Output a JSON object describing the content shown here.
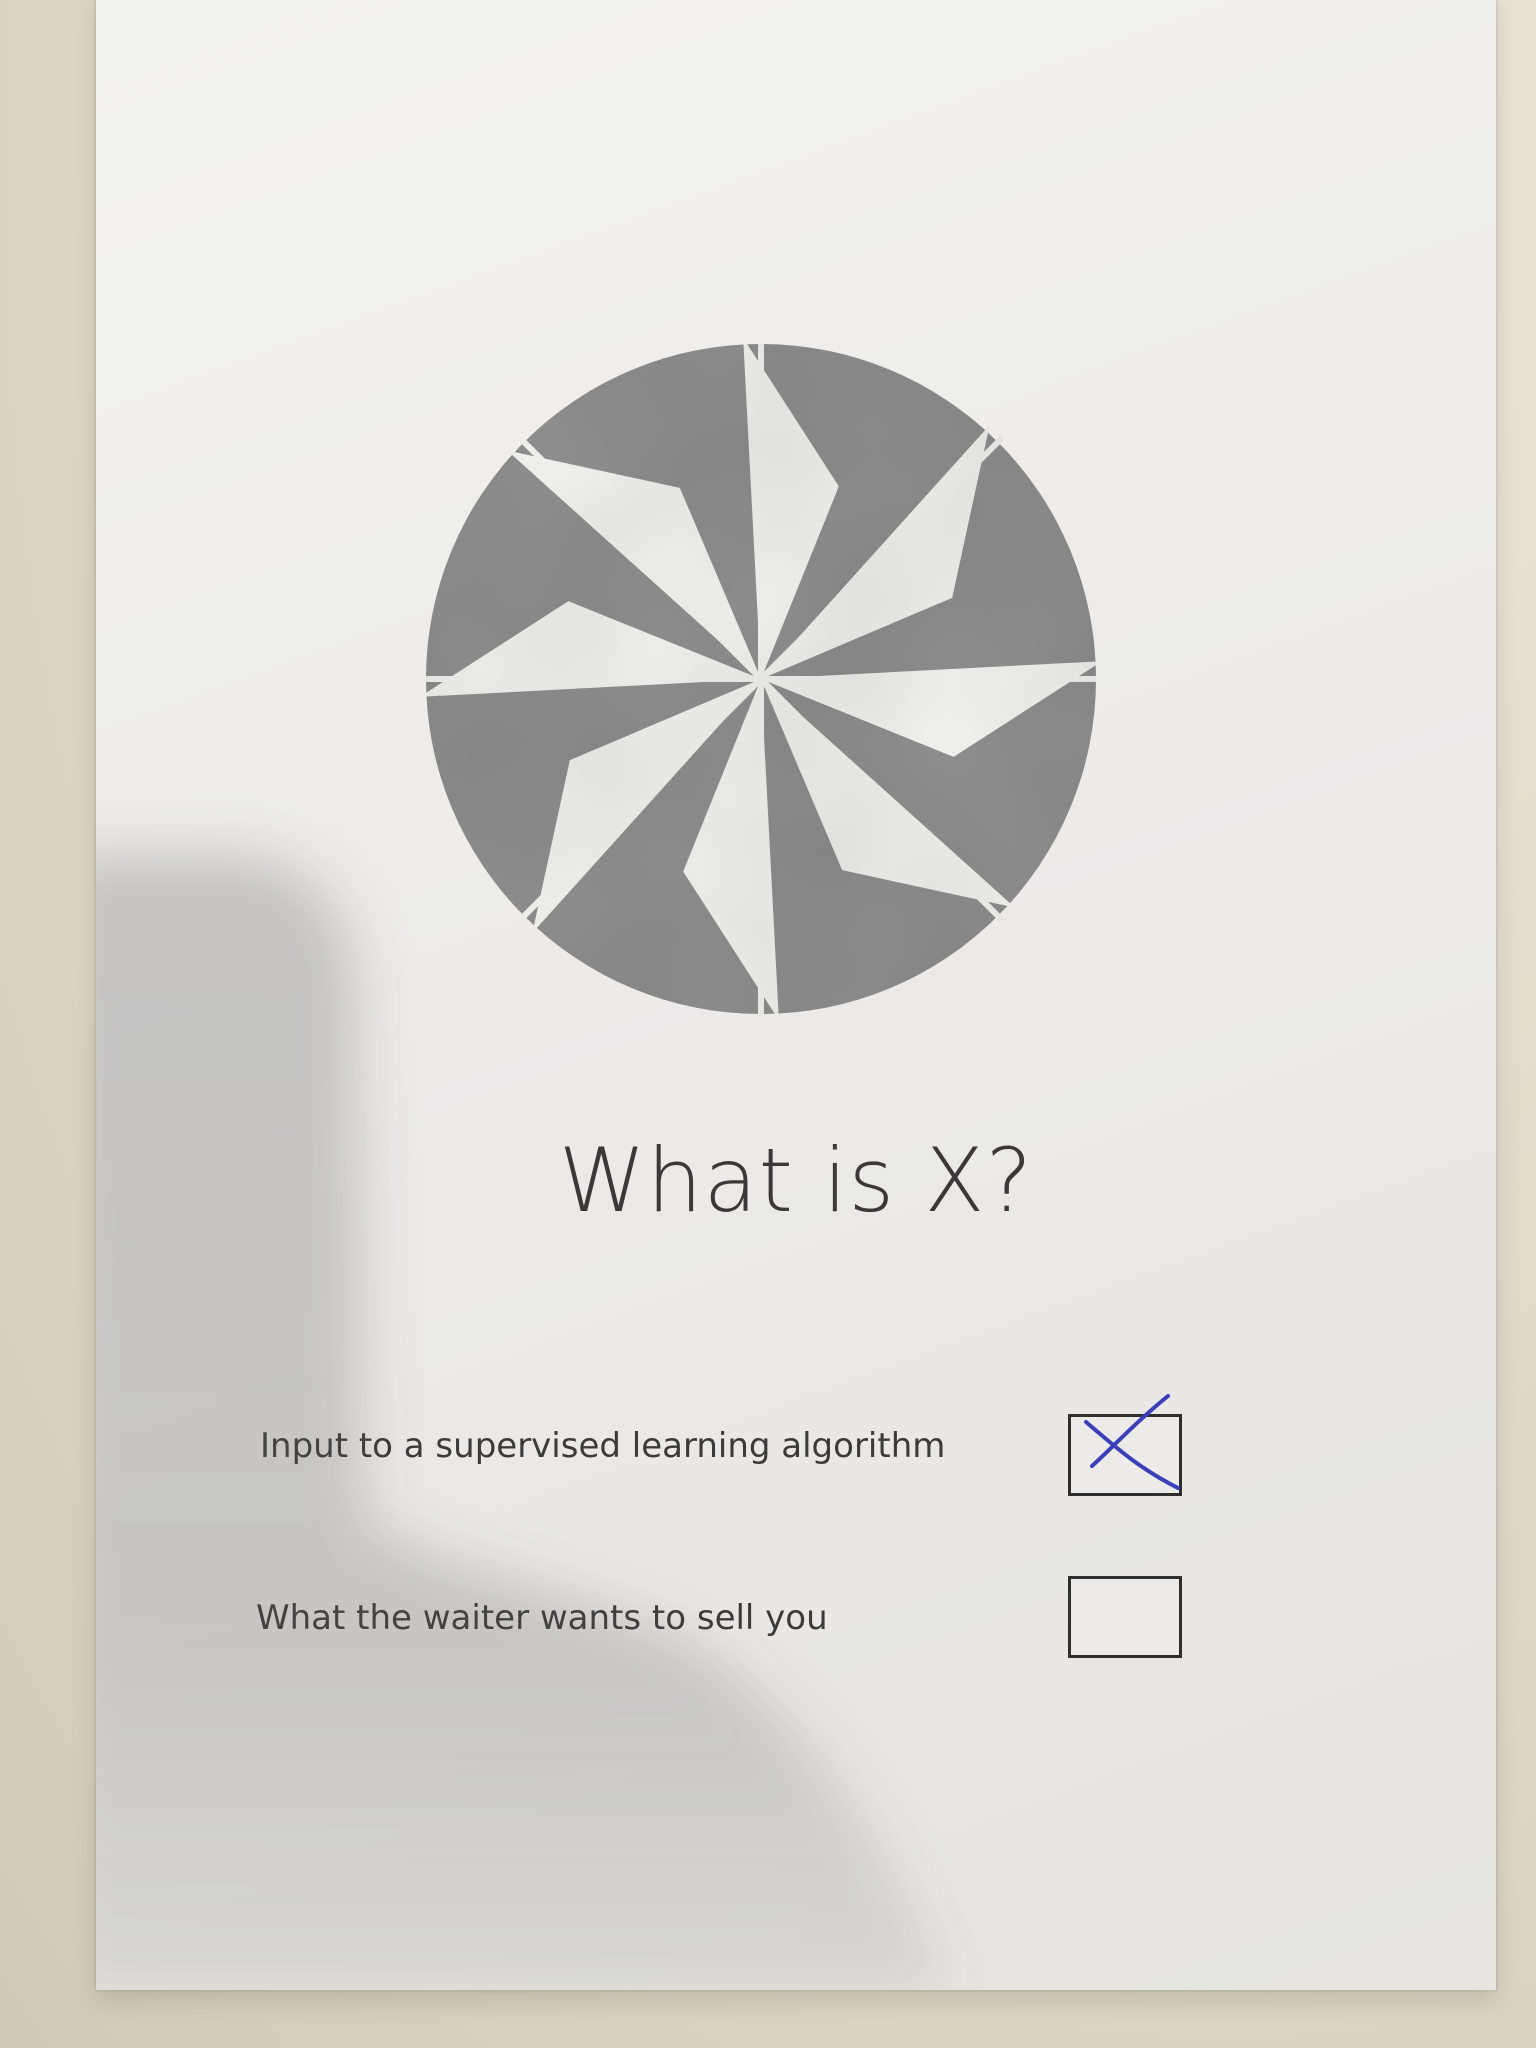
{
  "form": {
    "title": "What is X?",
    "options": [
      {
        "label": "Input to a supervised learning algorithm",
        "checked": true
      },
      {
        "label": "What the waiter wants to sell you",
        "checked": false
      }
    ]
  },
  "colors": {
    "logo": "#8f8f8f",
    "pen_mark": "#3b3fb8",
    "text": "#3a3838"
  },
  "icons": {
    "logo": "pinwheel-logo-icon",
    "mark": "x-mark-icon"
  }
}
